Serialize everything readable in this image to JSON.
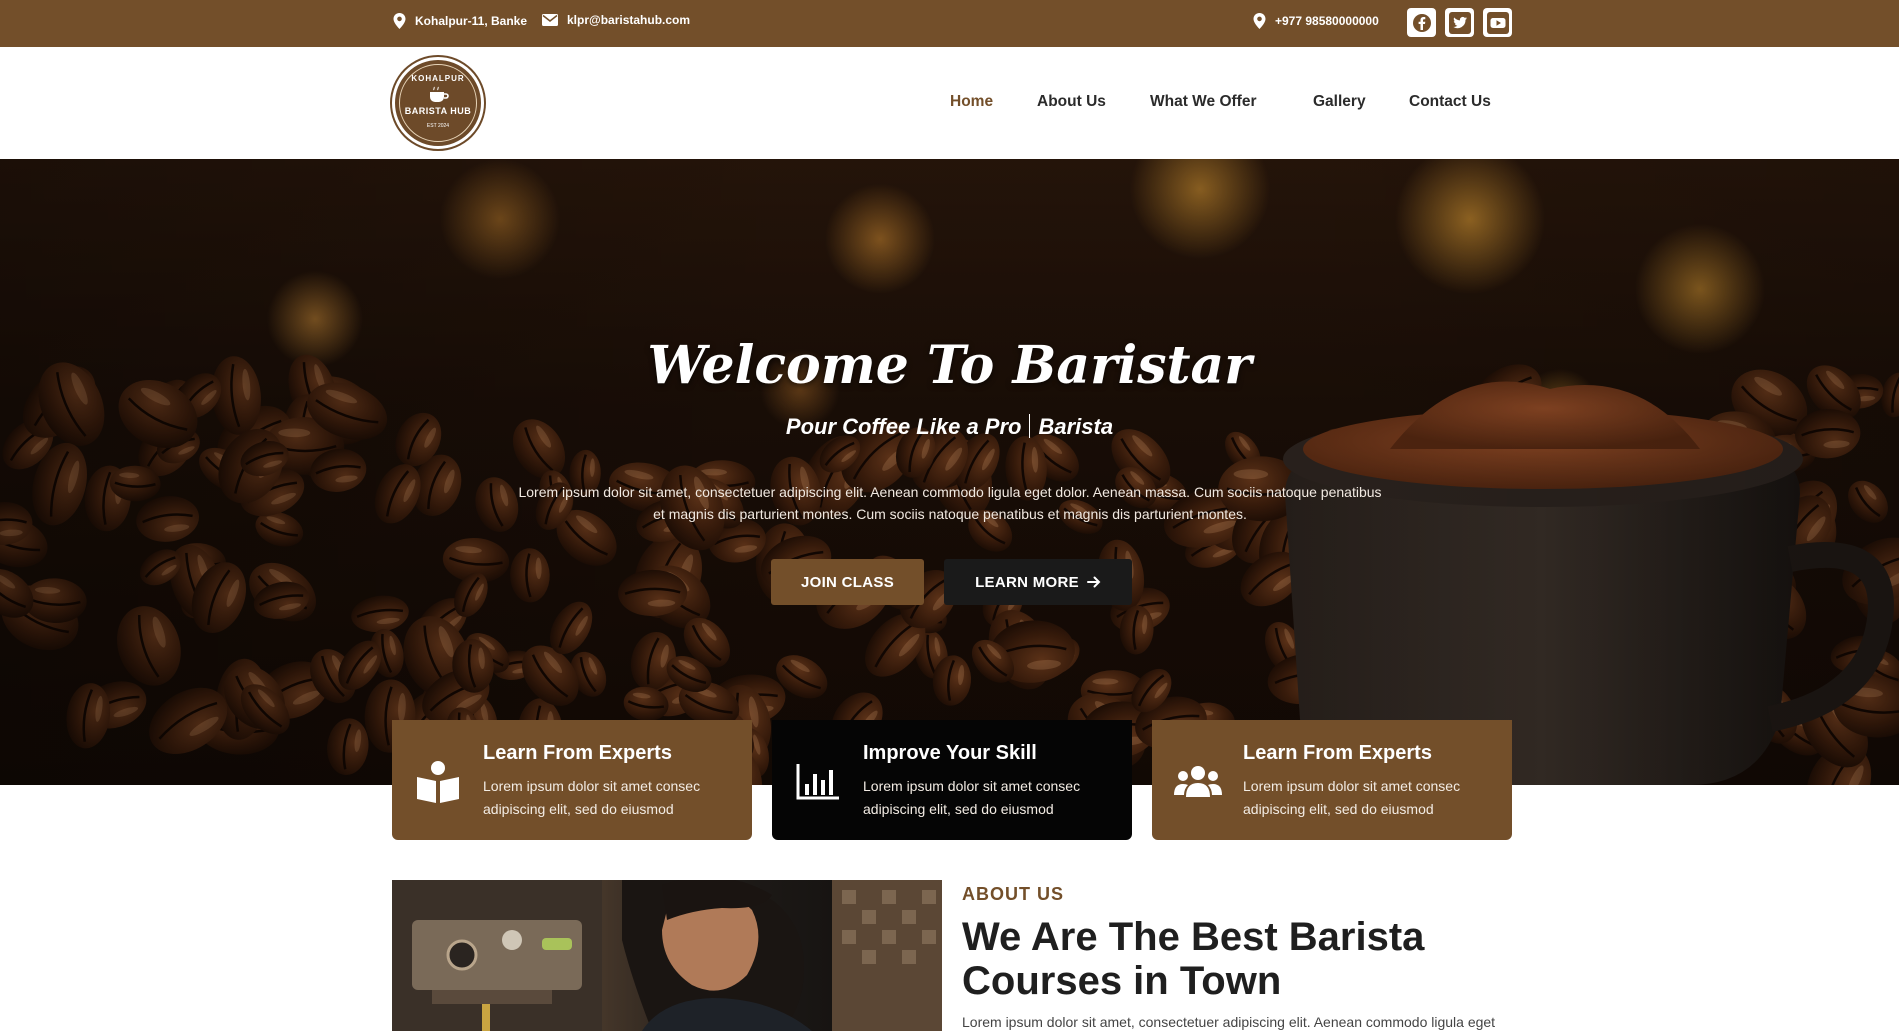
{
  "topbar": {
    "address": "Kohalpur-11, Banke",
    "email": "klpr@baristahub.com",
    "phone": "+977 98580000000",
    "social": [
      "facebook-icon",
      "twitter-icon",
      "youtube-icon"
    ]
  },
  "logo": {
    "top_text": "KOHALPUR",
    "main_text": "BARISTA HUB",
    "est_text": "EST 2024"
  },
  "nav": {
    "items": [
      {
        "label": "Home",
        "active": true
      },
      {
        "label": "About Us"
      },
      {
        "label": "What We Offer"
      },
      {
        "label": "Gallery"
      },
      {
        "label": "Contact Us"
      }
    ]
  },
  "hero": {
    "title": "Welcome To Baristar",
    "subtitle_a": "Pour Coffee Like a Pro",
    "subtitle_b": "Barista",
    "text_line1": "Lorem ipsum dolor sit amet, consectetuer adipiscing elit. Aenean commodo ligula eget dolor. Aenean massa. Cum sociis natoque penatibus",
    "text_line2": "et magnis dis parturient montes. Cum sociis natoque penatibus et magnis dis parturient montes.",
    "join_label": "JOIN CLASS",
    "learn_label": "LEARN MORE"
  },
  "features": [
    {
      "title": "Learn From Experts",
      "text": "Lorem ipsum dolor sit amet consec adipiscing elit, sed do eiusmod",
      "icon": "book-icon"
    },
    {
      "title": "Improve Your Skill",
      "text": "Lorem ipsum dolor sit amet consec adipiscing elit, sed do eiusmod",
      "icon": "chart-icon"
    },
    {
      "title": "Learn From Experts",
      "text": "Lorem ipsum dolor sit amet consec adipiscing elit, sed do eiusmod",
      "icon": "users-icon"
    }
  ],
  "about": {
    "label": "ABOUT US",
    "title": "We Are The Best Barista Courses in Town",
    "text": "Lorem ipsum dolor sit amet, consectetuer adipiscing elit. Aenean commodo ligula eget"
  },
  "colors": {
    "brand_brown": "#734f2a",
    "dark": "#1a1a1a"
  }
}
